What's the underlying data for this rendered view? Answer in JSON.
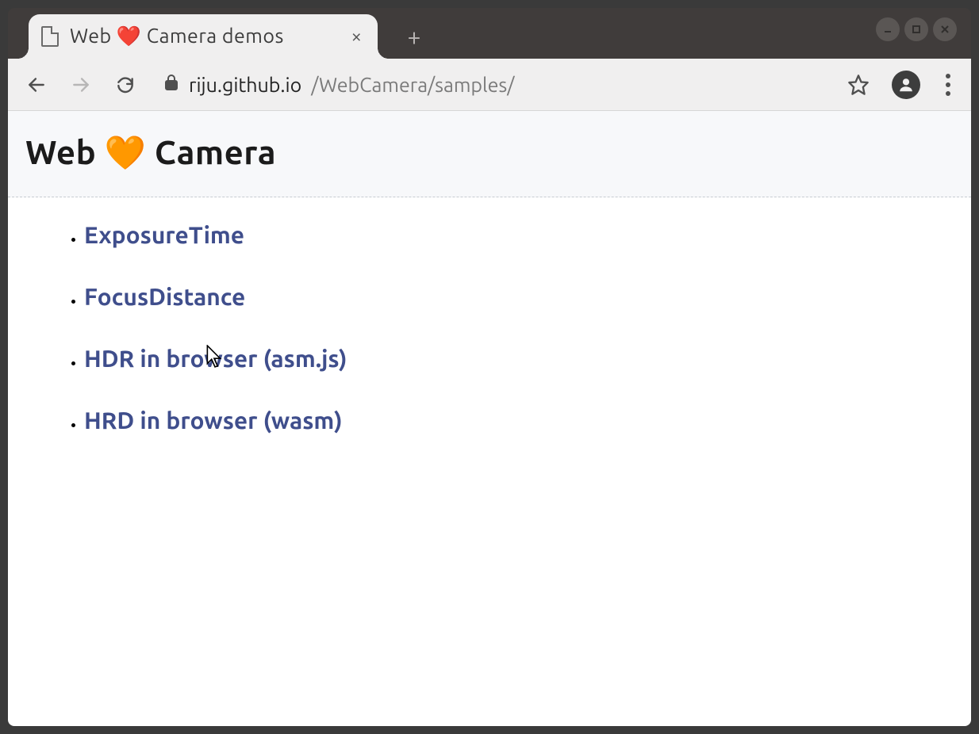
{
  "tab": {
    "title": "Web ❤️ Camera demos"
  },
  "address": {
    "host": "riju.github.io",
    "path": "/WebCamera/samples/"
  },
  "page": {
    "heading": "Web 🧡 Camera",
    "links": [
      {
        "label": "ExposureTime"
      },
      {
        "label": "FocusDistance"
      },
      {
        "label": "HDR in browser (asm.js)"
      },
      {
        "label": "HRD in browser (wasm)"
      }
    ]
  },
  "icons": {
    "new_tab": "+",
    "close": "×"
  }
}
